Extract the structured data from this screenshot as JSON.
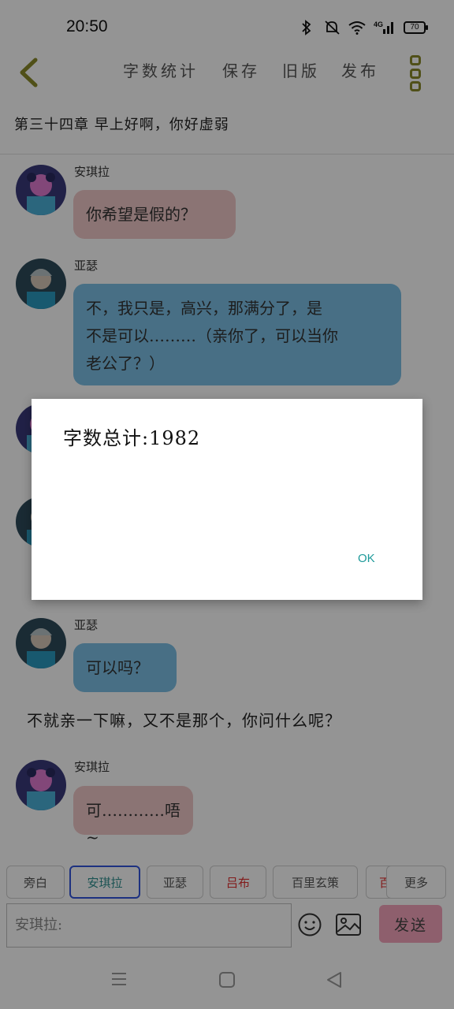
{
  "status_bar": {
    "time": "20:50",
    "battery": "70",
    "network": "4G",
    "icons": [
      "bluetooth-icon",
      "mute-icon",
      "wifi-icon",
      "signal-icon",
      "battery-icon"
    ]
  },
  "toolbar": {
    "back_icon": "chevron-left-icon",
    "actions": [
      "字数统计",
      "保存",
      "旧版",
      "发布"
    ],
    "menu_icon": "more-vertical-icon"
  },
  "chapter_title": "第三十四章   早上好啊，你好虚弱",
  "messages": [
    {
      "sender": "安琪拉",
      "text": "你希望是假的？",
      "style": "pink"
    },
    {
      "sender": "亚瑟",
      "text_lines": [
        "不，我只是，高兴，那满分了，是",
        "不是可以………（亲你了，可以当你",
        "老公了？）"
      ],
      "style": "blue"
    },
    {
      "sender": "亚瑟",
      "text": "可以吗？",
      "style": "blue"
    },
    {
      "sender": "安琪拉",
      "text": "可…………唔~",
      "style": "pink"
    }
  ],
  "narration": "不就亲一下嘛，又不是那个，你问什么呢？",
  "composer": {
    "role_chips": [
      "旁白",
      "安琪拉",
      "亚瑟",
      "吕布",
      "百里玄策",
      "百"
    ],
    "selected_role": "安琪拉",
    "more_label": "更多",
    "input_value": "安琪拉:",
    "send_label": "发送",
    "emoji_icon": "emoji-icon",
    "image_icon": "image-icon"
  },
  "dialog": {
    "message": "字数总计:1982",
    "ok_label": "OK"
  },
  "colors": {
    "pink_bubble": "#f0c8c8",
    "blue_bubble": "#7cc0e6",
    "send_button": "#f4a4bc",
    "ok_accent": "#1e9a9a",
    "selected_chip_border": "#3355dd"
  }
}
